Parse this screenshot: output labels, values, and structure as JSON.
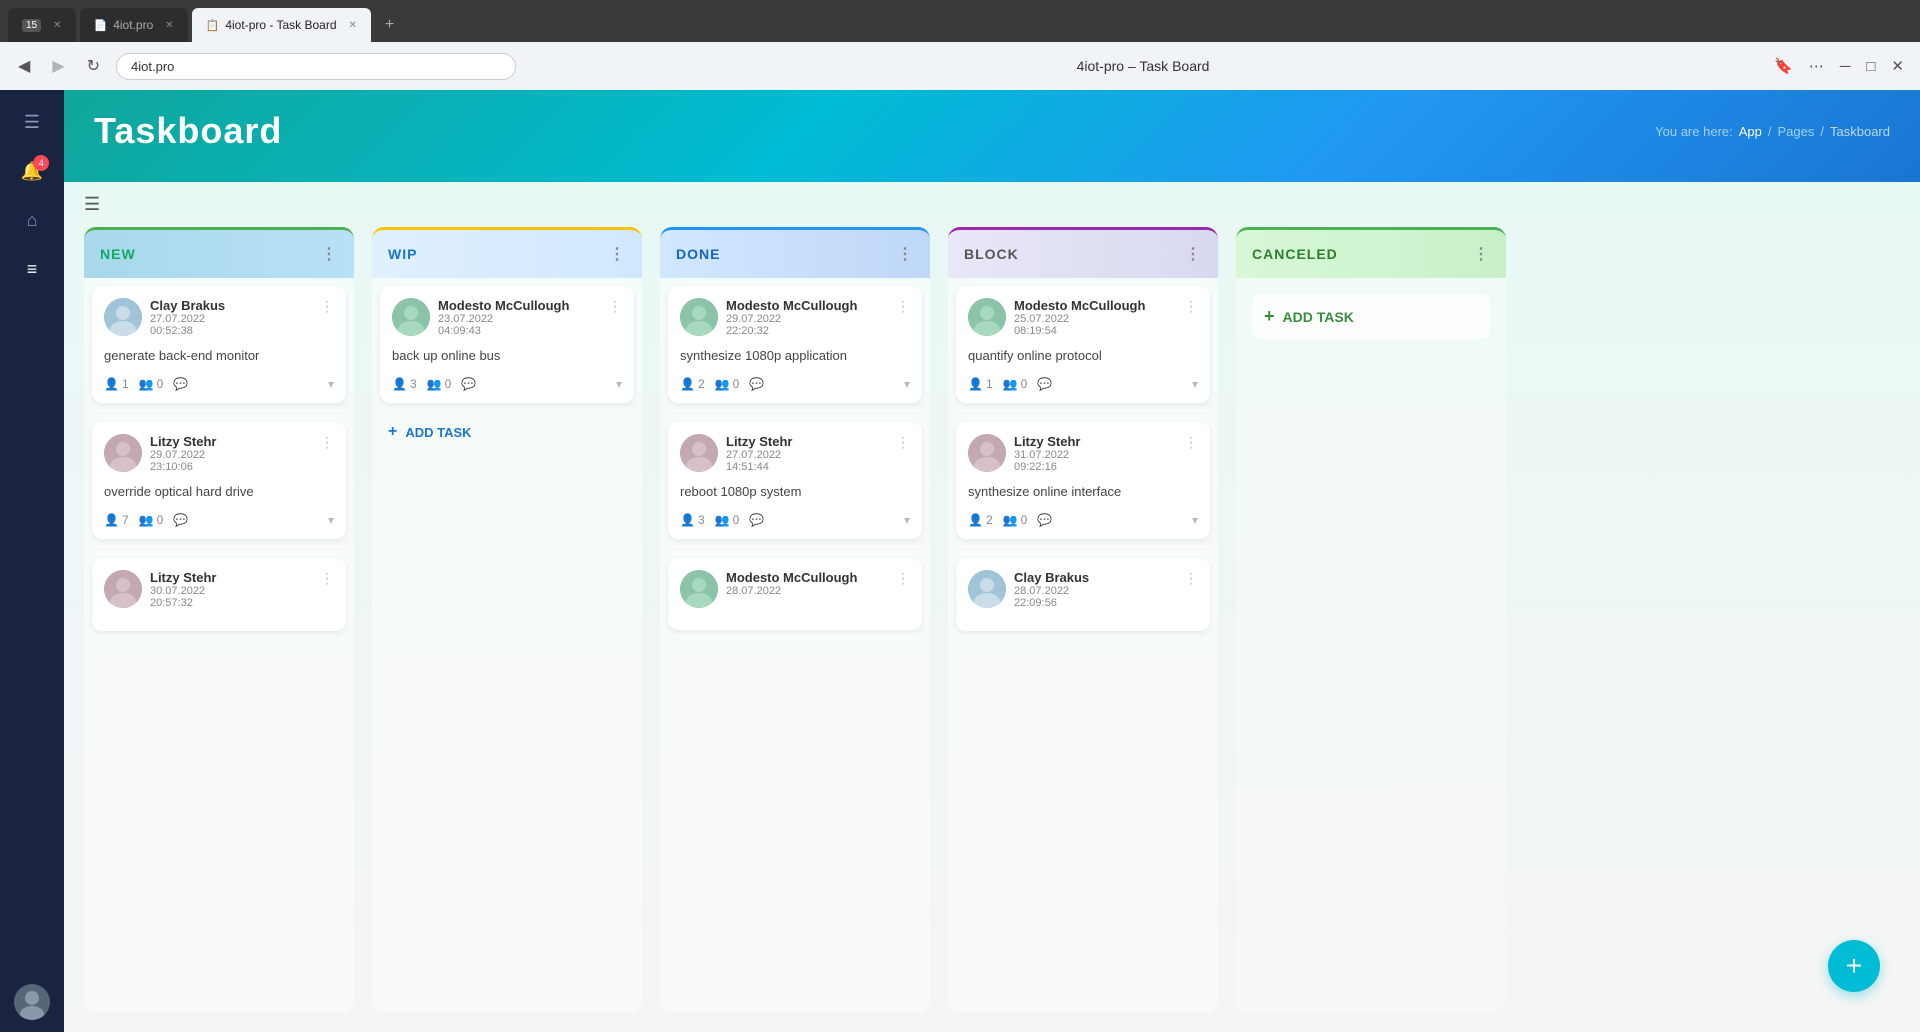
{
  "browser": {
    "tabs": [
      {
        "id": "tab1",
        "label": "15",
        "icon": "🕐",
        "active": false
      },
      {
        "id": "tab2",
        "label": "4iot.pro",
        "icon": "📄",
        "active": false
      },
      {
        "id": "tab3",
        "label": "4iot-pro - Task Board",
        "icon": "📋",
        "active": true
      }
    ],
    "address": "4iot.pro",
    "page_title": "4iot-pro – Task Board"
  },
  "breadcrumb": {
    "prefix": "You are here:",
    "items": [
      "App",
      "Pages",
      "Taskboard"
    ]
  },
  "app": {
    "title": "Taskboard"
  },
  "columns": [
    {
      "id": "new",
      "label": "NEW",
      "color_class": "new",
      "cards": [
        {
          "name": "Clay Brakus",
          "date": "27.07.2022",
          "time": "00:52:38",
          "title": "generate back-end monitor",
          "persons": 1,
          "groups": 0,
          "comments": 0
        },
        {
          "name": "Litzy Stehr",
          "date": "29.07.2022",
          "time": "23:10:06",
          "title": "override optical hard drive",
          "persons": 7,
          "groups": 0,
          "comments": 0
        },
        {
          "name": "Litzy Stehr",
          "date": "30.07.2022",
          "time": "20:57:32",
          "title": "",
          "persons": 0,
          "groups": 0,
          "comments": 0
        }
      ],
      "show_add": false
    },
    {
      "id": "wip",
      "label": "WIP",
      "color_class": "wip",
      "cards": [
        {
          "name": "Modesto McCullough",
          "date": "23.07.2022",
          "time": "04:09:43",
          "title": "back up online bus",
          "persons": 3,
          "groups": 0,
          "comments": 0
        }
      ],
      "show_add": true,
      "add_label": "ADD TASK"
    },
    {
      "id": "done",
      "label": "DONE",
      "color_class": "done",
      "cards": [
        {
          "name": "Modesto McCullough",
          "date": "29.07.2022",
          "time": "22:20:32",
          "title": "synthesize 1080p application",
          "persons": 2,
          "groups": 0,
          "comments": 0
        },
        {
          "name": "Litzy Stehr",
          "date": "27.07.2022",
          "time": "14:51:44",
          "title": "reboot 1080p system",
          "persons": 3,
          "groups": 0,
          "comments": 0
        },
        {
          "name": "Modesto McCullough",
          "date": "28.07.2022",
          "time": "",
          "title": "",
          "persons": 0,
          "groups": 0,
          "comments": 0
        }
      ],
      "show_add": false
    },
    {
      "id": "block",
      "label": "BLOCK",
      "color_class": "block",
      "cards": [
        {
          "name": "Modesto McCullough",
          "date": "25.07.2022",
          "time": "08:19:54",
          "title": "quantify online protocol",
          "persons": 1,
          "groups": 0,
          "comments": 0
        },
        {
          "name": "Litzy Stehr",
          "date": "31.07.2022",
          "time": "09:22:16",
          "title": "synthesize online interface",
          "persons": 2,
          "groups": 0,
          "comments": 0
        },
        {
          "name": "Clay Brakus",
          "date": "28.07.2022",
          "time": "22:09:56",
          "title": "",
          "persons": 0,
          "groups": 0,
          "comments": 0
        }
      ],
      "show_add": false
    },
    {
      "id": "canceled",
      "label": "CANCELED",
      "color_class": "canceled",
      "cards": [],
      "show_add": true,
      "add_label": "ADD TASK"
    }
  ],
  "fab": {
    "label": "+"
  },
  "icons": {
    "menu": "☰",
    "bell": "🔔",
    "home": "⌂",
    "list": "☰",
    "person": "👤",
    "chevron_down": "▾",
    "more_vert": "⋮",
    "plus": "+",
    "person_icon": "👤",
    "group_icon": "👥",
    "comment_icon": "💬"
  },
  "sidebar": {
    "badge_count": "4",
    "items": [
      {
        "id": "menu",
        "icon": "menu"
      },
      {
        "id": "bell",
        "icon": "bell",
        "badge": "4"
      },
      {
        "id": "home",
        "icon": "home"
      },
      {
        "id": "list",
        "icon": "list"
      }
    ]
  }
}
